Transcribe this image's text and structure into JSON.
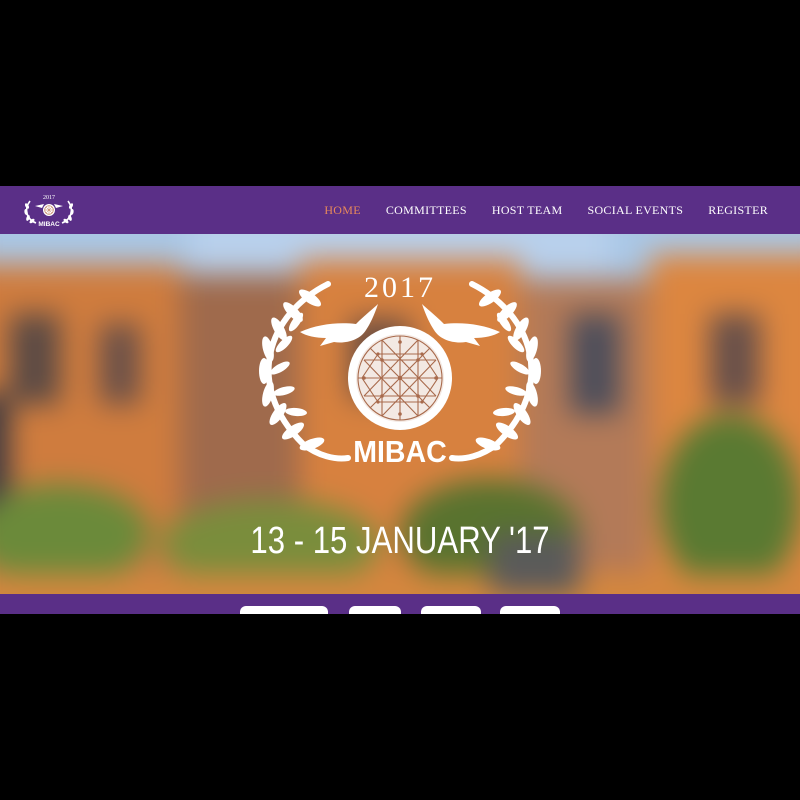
{
  "brand": {
    "name": "MIBAC",
    "year": "2017"
  },
  "nav": {
    "items": [
      {
        "label": "HOME",
        "active": true
      },
      {
        "label": "COMMITTEES",
        "active": false
      },
      {
        "label": "HOST TEAM",
        "active": false
      },
      {
        "label": "SOCIAL EVENTS",
        "active": false
      },
      {
        "label": "REGISTER",
        "active": false
      }
    ]
  },
  "hero": {
    "year": "2017",
    "brand": "MIBAC",
    "dates": "13 - 15 JANUARY '17"
  },
  "colors": {
    "nav_background": "#5a2f87",
    "active_link": "#e8895a",
    "text": "#ffffff",
    "letterbox": "#000000"
  },
  "icons": {
    "logo": "laurel-wreath-globe-doves-logo"
  }
}
